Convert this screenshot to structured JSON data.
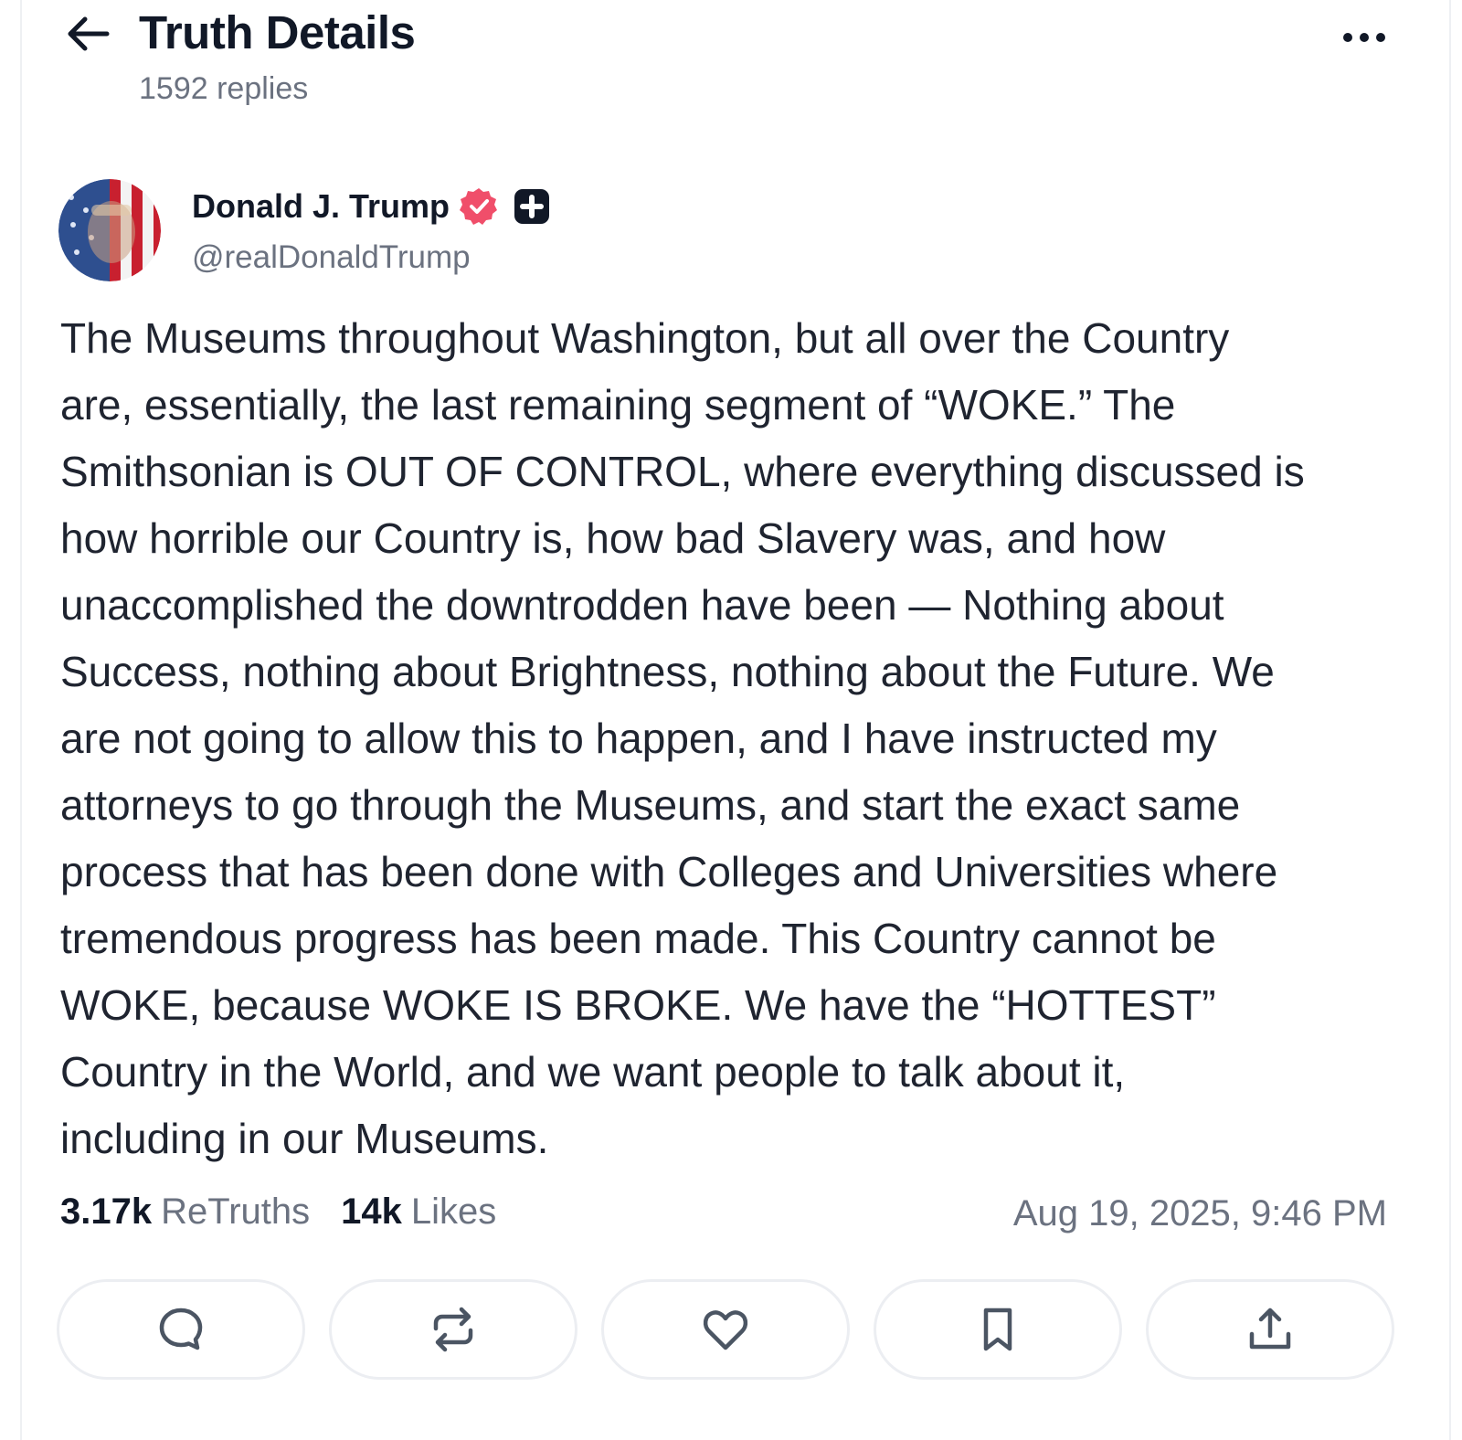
{
  "header": {
    "title": "Truth Details",
    "reply_count": "1592 replies"
  },
  "author": {
    "display_name": "Donald J. Trump",
    "handle": "@realDonaldTrump",
    "verified": true,
    "verified_color": "#f04e6a"
  },
  "post": {
    "text": "The Museums throughout Washington, but all over the Country\nare, essentially, the last remaining segment of “WOKE.” The\nSmithsonian is OUT OF CONTROL, where everything discussed is\nhow horrible our Country is, how bad Slavery was, and how\nunaccomplished the downtrodden have been — Nothing about\nSuccess, nothing about Brightness, nothing about the Future. We\nare not going to allow this to happen, and I have instructed my\nattorneys to go through the Museums, and start the exact same\nprocess that has been done with Colleges and Universities where\ntremendous progress has been made. This Country cannot be\nWOKE, because WOKE IS BROKE. We have the “HOTTEST”\nCountry in the World, and we want people to talk about it,\nincluding in our Museums."
  },
  "stats": {
    "retruths_count": "3.17k",
    "retruths_label": "ReTruths",
    "likes_count": "14k",
    "likes_label": "Likes",
    "timestamp": "Aug 19, 2025, 9:46 PM"
  },
  "actions": [
    {
      "icon": "reply-icon"
    },
    {
      "icon": "retruth-icon"
    },
    {
      "icon": "heart-icon"
    },
    {
      "icon": "bookmark-icon"
    },
    {
      "icon": "share-icon"
    }
  ],
  "colors": {
    "text_primary": "#111827",
    "text_secondary": "#6b7280",
    "border": "#eceef2"
  }
}
